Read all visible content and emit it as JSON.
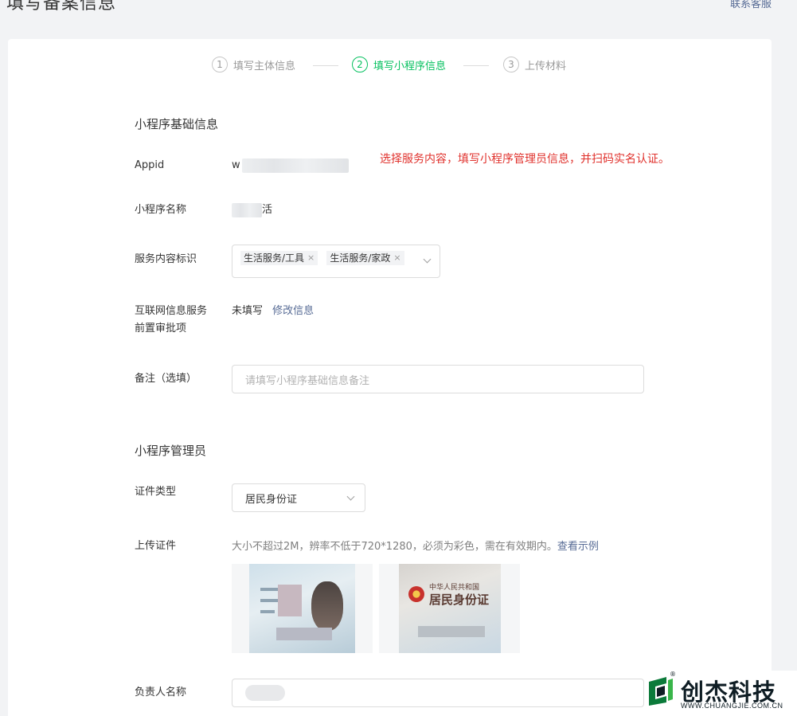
{
  "page": {
    "title": "填写备案信息",
    "top_link": "联系客服"
  },
  "steps": [
    {
      "num": "1",
      "label": "填写主体信息",
      "state": "done"
    },
    {
      "num": "2",
      "label": "填写小程序信息",
      "state": "active"
    },
    {
      "num": "3",
      "label": "上传材料",
      "state": "todo"
    }
  ],
  "basic": {
    "section_title": "小程序基础信息",
    "appid_label": "Appid",
    "appid_value_prefix": "w",
    "name_label": "小程序名称",
    "name_value_suffix": "活",
    "service_label": "服务内容标识",
    "service_tags": [
      "生活服务/工具",
      "生活服务/家政"
    ],
    "tag_remove_glyph": "×",
    "icp_label_line1": "互联网信息服务",
    "icp_label_line2": "前置审批项",
    "icp_status": "未填写",
    "icp_edit_link": "修改信息",
    "remark_label": "备注（选填）",
    "remark_placeholder": "请填写小程序基础信息备注"
  },
  "annotation": "选择服务内容，填写小程序管理员信息，并扫码实名认证。",
  "admin": {
    "section_title": "小程序管理员",
    "id_type_label": "证件类型",
    "id_type_value": "居民身份证",
    "upload_label": "上传证件",
    "upload_hint": "大小不超过2M，辨率不低于720*1280，必须为彩色，需在有效期内。",
    "upload_example_link": "查看示例",
    "id_back_line1": "中华人民共和国",
    "id_back_line2": "居民身份证",
    "owner_label": "负责人名称"
  },
  "watermark": {
    "name": "创杰科技",
    "url": "WWW.CHUANGJIE.COM.CN",
    "reg": "®"
  },
  "colors": {
    "accent_green": "#07c160",
    "link_blue": "#576b95",
    "annotation_red": "#e0322d"
  }
}
